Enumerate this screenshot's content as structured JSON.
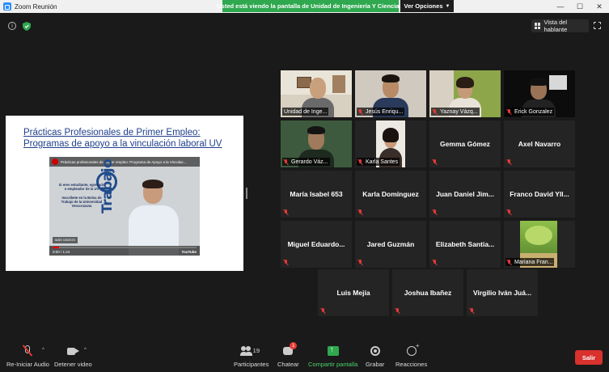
{
  "window": {
    "title": "Zoom Reunión",
    "minimize": "—",
    "maximize": "☐",
    "close": "✕"
  },
  "share_banner": {
    "text": "Usted está viendo la pantalla de Unidad de Ingeniería Y Ciencia...",
    "view_options": "Ver Opciones"
  },
  "top_right": {
    "speaker_view": "Vista del hablante"
  },
  "shared_screen": {
    "slide_title_line1": "Prácticas Profesionales de Primer Empleo:",
    "slide_title_line2": "Programas de apoyo a la vinculación laboral UV",
    "video": {
      "header": "Prácticas profesionales de primer empleo: Programa de Apoyo a la Vinculac...",
      "left_text": "Si eres estudiante, egresado o empleador de la UV",
      "left_text2": "Inscríbete en la Bolsa de Trabajo de la Universidad Veracruzana",
      "brand": "Trabajo",
      "chip": "MÁS VIDEOS",
      "time": "0:00 / 1:24",
      "yt_logo": "YouTube"
    }
  },
  "participants": [
    {
      "name": "Unidad de Inge...",
      "video": true,
      "active": true
    },
    {
      "name": "Jesús Enriqu...",
      "video": true,
      "active": false
    },
    {
      "name": "Yaznay Vázq...",
      "video": true,
      "active": false
    },
    {
      "name": "Erick Gonzalez",
      "video": true,
      "active": false
    },
    {
      "name": "Gerardo Váz...",
      "video": true,
      "active": false
    },
    {
      "name": "Karla Santes",
      "video": true,
      "active": false
    },
    {
      "name": "Gemma Gómez",
      "video": false
    },
    {
      "name": "Axel Navarro",
      "video": false
    },
    {
      "name": "María Isabel 653",
      "video": false
    },
    {
      "name": "Karla Domínguez",
      "video": false
    },
    {
      "name": "Juan Daniel Jim...",
      "video": false
    },
    {
      "name": "Franco David Yll...",
      "video": false
    },
    {
      "name": "Miguel Eduardo...",
      "video": false
    },
    {
      "name": "Jared Guzmán",
      "video": false
    },
    {
      "name": "Elizabeth Santia...",
      "video": false
    },
    {
      "name": "Mariana Fran...",
      "video": true,
      "image": "landscape"
    },
    {
      "name": "Luis Mejía",
      "video": false
    },
    {
      "name": "Joshua Ibañez",
      "video": false
    },
    {
      "name": "Virgilio Iván Juá...",
      "video": false
    }
  ],
  "toolbar": {
    "audio": "Re-Iniciar Audio",
    "video": "Detener video",
    "participants": "Participantes",
    "participants_count": "19",
    "chat": "Chatear",
    "chat_badge": "1",
    "share": "Compartir pantalla",
    "record": "Grabar",
    "reactions": "Reacciones",
    "leave": "Salir",
    "caret": "^"
  },
  "colors": {
    "share_green": "#2fa84f",
    "leave_red": "#d9312d",
    "active_speaker": "#b8e04a",
    "muted_red": "#e53935",
    "slide_title_blue": "#1f3f8c"
  }
}
